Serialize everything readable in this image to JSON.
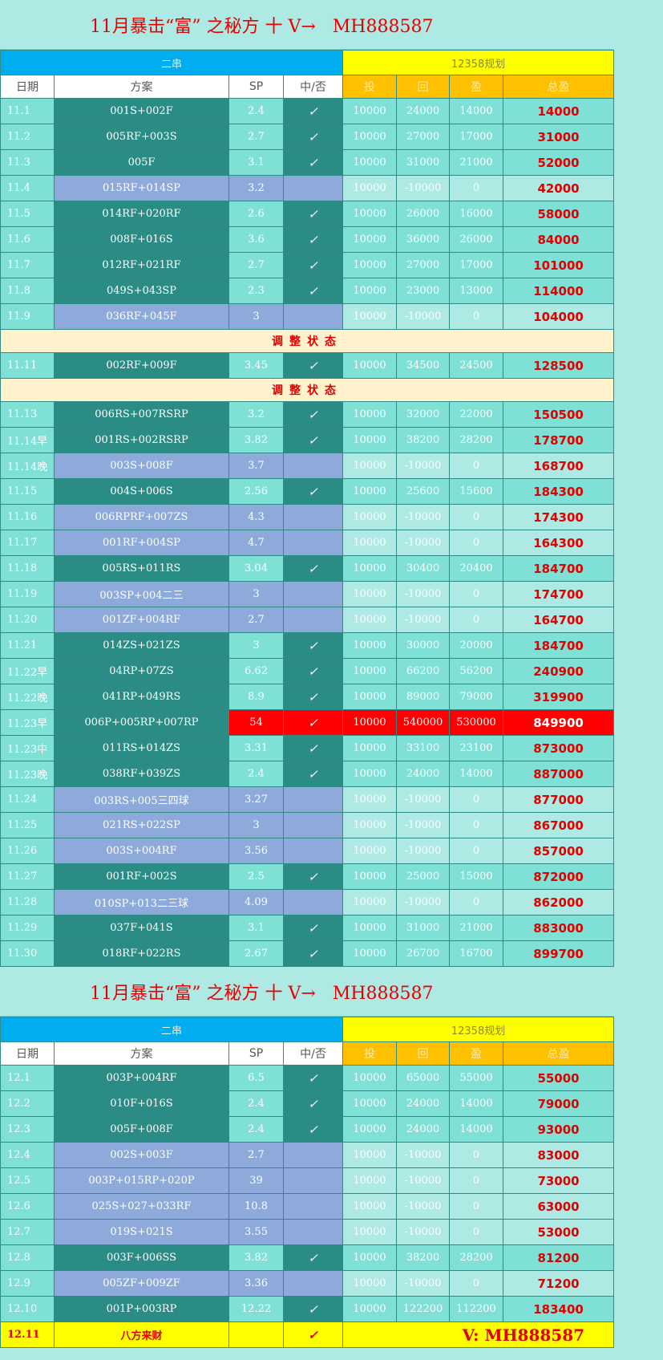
{
  "banner": "11月暴击“富” 之秘方 十 V→   MH888587",
  "header": {
    "left_group": "二串",
    "right_group": "12358规划",
    "columns": [
      "日期",
      "方案",
      "SP",
      "中/否",
      "投",
      "回",
      "盈",
      "总盈"
    ]
  },
  "adjust_label": "调整状态",
  "check_symbol": "✓",
  "section1": [
    {
      "date": "11.1",
      "plan": "001S+002F",
      "sp": "2.4",
      "hit": true,
      "tou": "10000",
      "hui": "24000",
      "ying": "14000",
      "total": "14000"
    },
    {
      "date": "11.2",
      "plan": "005RF+003S",
      "sp": "2.7",
      "hit": true,
      "tou": "10000",
      "hui": "27000",
      "ying": "17000",
      "total": "31000"
    },
    {
      "date": "11.3",
      "plan": "005F",
      "sp": "3.1",
      "hit": true,
      "tou": "10000",
      "hui": "31000",
      "ying": "21000",
      "total": "52000"
    },
    {
      "date": "11.4",
      "plan": "015RF+014SP",
      "sp": "3.2",
      "hit": false,
      "tou": "10000",
      "hui": "-10000",
      "ying": "0",
      "total": "42000"
    },
    {
      "date": "11.5",
      "plan": "014RF+020RF",
      "sp": "2.6",
      "hit": true,
      "tou": "10000",
      "hui": "26000",
      "ying": "16000",
      "total": "58000"
    },
    {
      "date": "11.6",
      "plan": "008F+016S",
      "sp": "3.6",
      "hit": true,
      "tou": "10000",
      "hui": "36000",
      "ying": "26000",
      "total": "84000"
    },
    {
      "date": "11.7",
      "plan": "012RF+021RF",
      "sp": "2.7",
      "hit": true,
      "tou": "10000",
      "hui": "27000",
      "ying": "17000",
      "total": "101000"
    },
    {
      "date": "11.8",
      "plan": "049S+043SP",
      "sp": "2.3",
      "hit": true,
      "tou": "10000",
      "hui": "23000",
      "ying": "13000",
      "total": "114000"
    },
    {
      "date": "11.9",
      "plan": "036RF+045F",
      "sp": "3",
      "hit": false,
      "tou": "10000",
      "hui": "-10000",
      "ying": "0",
      "total": "104000"
    },
    {
      "adjust": true
    },
    {
      "date": "11.11",
      "plan": "002RF+009F",
      "sp": "3.45",
      "hit": true,
      "tou": "10000",
      "hui": "34500",
      "ying": "24500",
      "total": "128500"
    },
    {
      "adjust": true
    },
    {
      "date": "11.13",
      "plan": "006RS+007RSRP",
      "sp": "3.2",
      "hit": true,
      "tou": "10000",
      "hui": "32000",
      "ying": "22000",
      "total": "150500"
    },
    {
      "date": "11.14早",
      "plan": "001RS+002RSRP",
      "sp": "3.82",
      "hit": true,
      "tou": "10000",
      "hui": "38200",
      "ying": "28200",
      "total": "178700"
    },
    {
      "date": "11.14晚",
      "plan": "003S+008F",
      "sp": "3.7",
      "hit": false,
      "tou": "10000",
      "hui": "-10000",
      "ying": "0",
      "total": "168700"
    },
    {
      "date": "11.15",
      "plan": "004S+006S",
      "sp": "2.56",
      "hit": true,
      "tou": "10000",
      "hui": "25600",
      "ying": "15600",
      "total": "184300"
    },
    {
      "date": "11.16",
      "plan": "006RPRF+007ZS",
      "sp": "4.3",
      "hit": false,
      "tou": "10000",
      "hui": "-10000",
      "ying": "0",
      "total": "174300"
    },
    {
      "date": "11.17",
      "plan": "001RF+004SP",
      "sp": "4.7",
      "hit": false,
      "tou": "10000",
      "hui": "-10000",
      "ying": "0",
      "total": "164300"
    },
    {
      "date": "11.18",
      "plan": "005RS+011RS",
      "sp": "3.04",
      "hit": true,
      "tou": "10000",
      "hui": "30400",
      "ying": "20400",
      "total": "184700"
    },
    {
      "date": "11.19",
      "plan": "003SP+004二三",
      "sp": "3",
      "hit": false,
      "tou": "10000",
      "hui": "-10000",
      "ying": "0",
      "total": "174700"
    },
    {
      "date": "11.20",
      "plan": "001ZF+004RF",
      "sp": "2.7",
      "hit": false,
      "tou": "10000",
      "hui": "-10000",
      "ying": "0",
      "total": "164700"
    },
    {
      "date": "11.21",
      "plan": "014ZS+021ZS",
      "sp": "3",
      "hit": true,
      "tou": "10000",
      "hui": "30000",
      "ying": "20000",
      "total": "184700"
    },
    {
      "date": "11.22早",
      "plan": "04RP+07ZS",
      "sp": "6.62",
      "hit": true,
      "tou": "10000",
      "hui": "66200",
      "ying": "56200",
      "total": "240900"
    },
    {
      "date": "11.22晚",
      "plan": "041RP+049RS",
      "sp": "8.9",
      "hit": true,
      "tou": "10000",
      "hui": "89000",
      "ying": "79000",
      "total": "319900"
    },
    {
      "date": "11.23早",
      "plan": "006P+005RP+007RP",
      "sp": "54",
      "hit": true,
      "big": true,
      "tou": "10000",
      "hui": "540000",
      "ying": "530000",
      "total": "849900"
    },
    {
      "date": "11.23中",
      "plan": "011RS+014ZS",
      "sp": "3.31",
      "hit": true,
      "tou": "10000",
      "hui": "33100",
      "ying": "23100",
      "total": "873000"
    },
    {
      "date": "11.23晚",
      "plan": "038RF+039ZS",
      "sp": "2.4",
      "hit": true,
      "tou": "10000",
      "hui": "24000",
      "ying": "14000",
      "total": "887000"
    },
    {
      "date": "11.24",
      "plan": "003RS+005三四球",
      "sp": "3.27",
      "hit": false,
      "tou": "10000",
      "hui": "-10000",
      "ying": "0",
      "total": "877000"
    },
    {
      "date": "11.25",
      "plan": "021RS+022SP",
      "sp": "3",
      "hit": false,
      "tou": "10000",
      "hui": "-10000",
      "ying": "0",
      "total": "867000"
    },
    {
      "date": "11.26",
      "plan": "003S+004RF",
      "sp": "3.56",
      "hit": false,
      "tou": "10000",
      "hui": "-10000",
      "ying": "0",
      "total": "857000"
    },
    {
      "date": "11.27",
      "plan": "001RF+002S",
      "sp": "2.5",
      "hit": true,
      "tou": "10000",
      "hui": "25000",
      "ying": "15000",
      "total": "872000"
    },
    {
      "date": "11.28",
      "plan": "010SP+013二三球",
      "sp": "4.09",
      "hit": false,
      "tou": "10000",
      "hui": "-10000",
      "ying": "0",
      "total": "862000"
    },
    {
      "date": "11.29",
      "plan": "037F+041S",
      "sp": "3.1",
      "hit": true,
      "tou": "10000",
      "hui": "31000",
      "ying": "21000",
      "total": "883000"
    },
    {
      "date": "11.30",
      "plan": "018RF+022RS",
      "sp": "2.67",
      "hit": true,
      "tou": "10000",
      "hui": "26700",
      "ying": "16700",
      "total": "899700"
    }
  ],
  "section2": [
    {
      "date": "12.1",
      "plan": "003P+004RF",
      "sp": "6.5",
      "hit": true,
      "tou": "10000",
      "hui": "65000",
      "ying": "55000",
      "total": "55000"
    },
    {
      "date": "12.2",
      "plan": "010F+016S",
      "sp": "2.4",
      "hit": true,
      "tou": "10000",
      "hui": "24000",
      "ying": "14000",
      "total": "79000"
    },
    {
      "date": "12.3",
      "plan": "005F+008F",
      "sp": "2.4",
      "hit": true,
      "tou": "10000",
      "hui": "24000",
      "ying": "14000",
      "total": "93000"
    },
    {
      "date": "12.4",
      "plan": "002S+003F",
      "sp": "2.7",
      "hit": false,
      "tou": "10000",
      "hui": "-10000",
      "ying": "0",
      "total": "83000"
    },
    {
      "date": "12.5",
      "plan": "003P+015RP+020P",
      "sp": "39",
      "hit": false,
      "tou": "10000",
      "hui": "-10000",
      "ying": "0",
      "total": "73000"
    },
    {
      "date": "12.6",
      "plan": "025S+027+033RF",
      "sp": "10.8",
      "hit": false,
      "tou": "10000",
      "hui": "-10000",
      "ying": "0",
      "total": "63000"
    },
    {
      "date": "12.7",
      "plan": "019S+021S",
      "sp": "3.55",
      "hit": false,
      "tou": "10000",
      "hui": "-10000",
      "ying": "0",
      "total": "53000"
    },
    {
      "date": "12.8",
      "plan": "003F+006SS",
      "sp": "3.82",
      "hit": true,
      "tou": "10000",
      "hui": "38200",
      "ying": "28200",
      "total": "81200"
    },
    {
      "date": "12.9",
      "plan": "005ZF+009ZF",
      "sp": "3.36",
      "hit": false,
      "tou": "10000",
      "hui": "-10000",
      "ying": "0",
      "total": "71200"
    },
    {
      "date": "12.10",
      "plan": "001P+003RP",
      "sp": "12.22",
      "hit": true,
      "tou": "10000",
      "hui": "122200",
      "ying": "112200",
      "total": "183400"
    }
  ],
  "final_row": {
    "date": "12.11",
    "plan": "八方来财",
    "hit": true,
    "contact": "V: MH888587"
  }
}
